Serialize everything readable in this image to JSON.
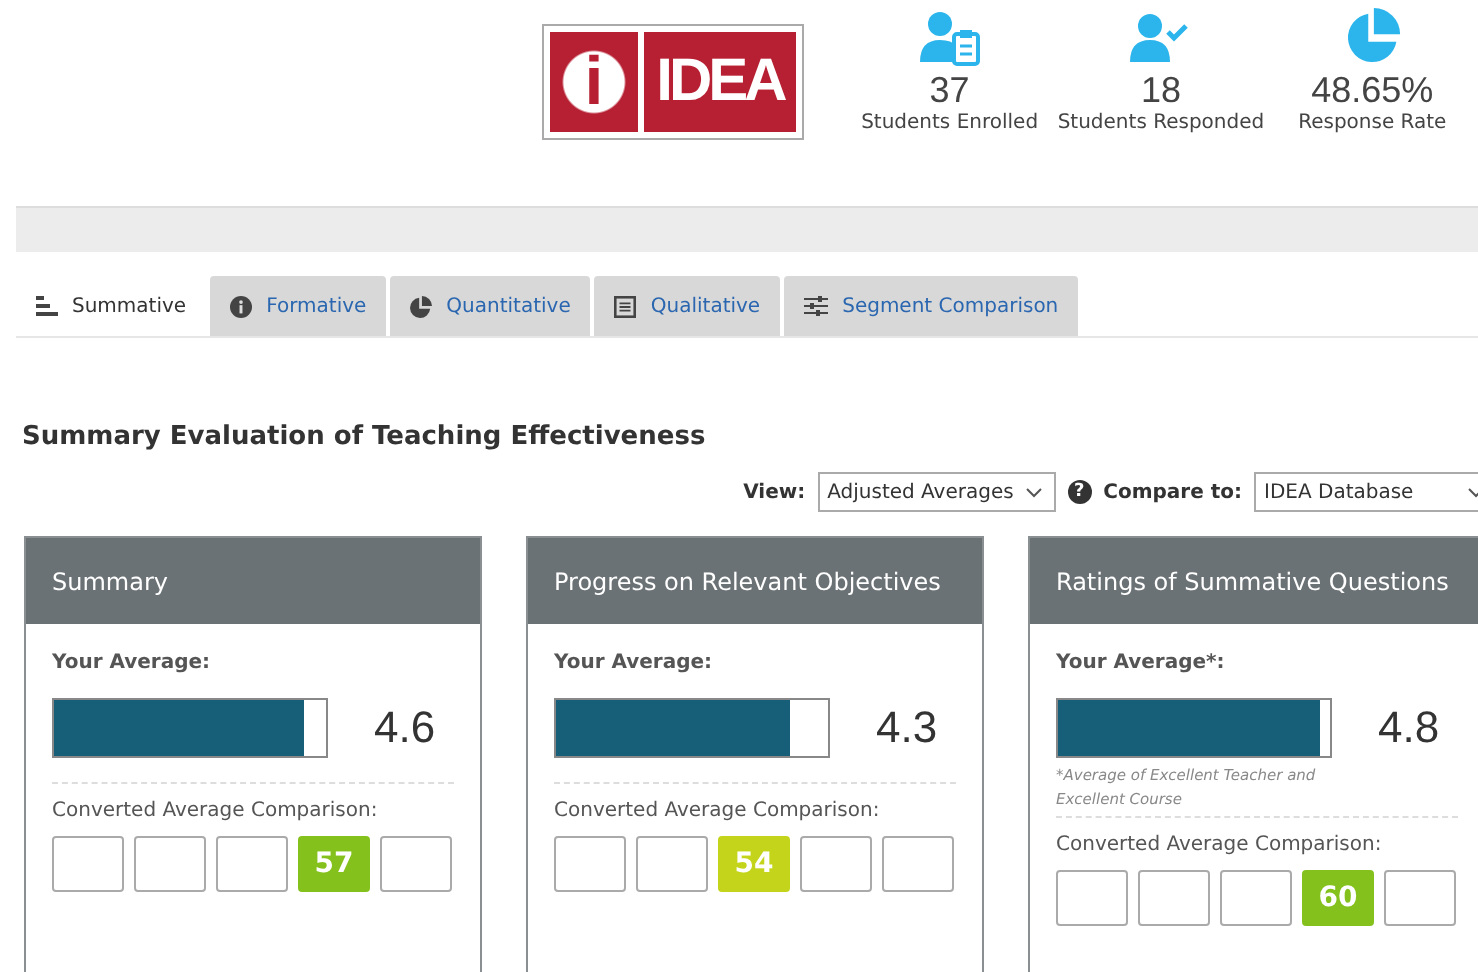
{
  "logo": {
    "glyph": "i",
    "text": "IDEA"
  },
  "stats": [
    {
      "kind": "enrolled",
      "value": "37",
      "label": "Students Enrolled"
    },
    {
      "kind": "responded",
      "value": "18",
      "label": "Students Responded"
    },
    {
      "kind": "rate",
      "value": "48.65%",
      "label": "Response Rate"
    }
  ],
  "tabs": [
    {
      "kind": "summative",
      "label": "Summative",
      "selected": true
    },
    {
      "kind": "formative",
      "label": "Formative",
      "selected": false
    },
    {
      "kind": "quantitative",
      "label": "Quantitative",
      "selected": false
    },
    {
      "kind": "qualitative",
      "label": "Qualitative",
      "selected": false
    },
    {
      "kind": "segment",
      "label": "Segment Comparison",
      "selected": false
    }
  ],
  "title": "Summary Evaluation of Teaching Effectiveness",
  "view": {
    "label": "View:",
    "value": "Adjusted Averages"
  },
  "help_glyph": "?",
  "compare": {
    "label": "Compare to:",
    "value": "IDEA Database"
  },
  "cards": [
    {
      "title": "Summary",
      "average_label": "Your Average:",
      "level": 0.92,
      "score": "4.6",
      "comparison_label": "Converted Average Comparison:",
      "slots": [
        {
          "selected": false
        },
        {
          "selected": false
        },
        {
          "selected": false
        },
        {
          "selected": true,
          "value": "57",
          "color": "#84c11c"
        },
        {
          "selected": false
        }
      ]
    },
    {
      "title": "Progress on Relevant Objectives",
      "average_label": "Your Average:",
      "level": 0.86,
      "score": "4.3",
      "comparison_label": "Converted Average Comparison:",
      "slots": [
        {
          "selected": false
        },
        {
          "selected": false
        },
        {
          "selected": true,
          "value": "54",
          "color": "#c3d41b"
        },
        {
          "selected": false
        },
        {
          "selected": false
        }
      ]
    },
    {
      "title": "Ratings of Summative Questions",
      "average_label": "Your Average*:",
      "level": 0.96,
      "score": "4.8",
      "note": "*Average of Excellent Teacher and Excellent Course",
      "comparison_label": "Converted Average Comparison:",
      "slots": [
        {
          "selected": false
        },
        {
          "selected": false
        },
        {
          "selected": false
        },
        {
          "selected": true,
          "value": "60",
          "color": "#84c11c"
        },
        {
          "selected": false
        }
      ]
    }
  ]
}
